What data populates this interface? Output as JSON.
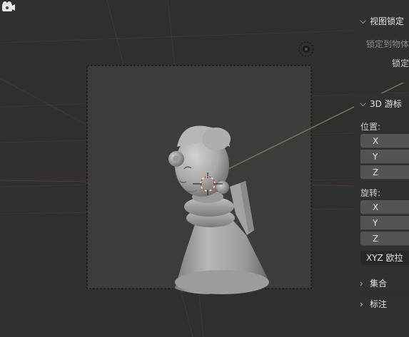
{
  "sidebar": {
    "view_lock_header": "视图锁定",
    "lock_to_object_label": "锁定到物体",
    "lock_label": "锁定",
    "cursor_header": "3D 游标",
    "location_label": "位置:",
    "location_fields": [
      "X",
      "Y",
      "Z"
    ],
    "rotation_label": "旋转:",
    "rotation_fields": [
      "X",
      "Y",
      "Z"
    ],
    "rotation_mode": "XYZ 欧拉",
    "collection_header": "集合",
    "annotation_header": "标注"
  },
  "icons": {
    "expanded": "chevron-down-icon",
    "collapsed": "chevron-right-icon",
    "camera": "camera-icon",
    "cursor": "3d-cursor-icon",
    "light": "light-icon"
  },
  "colors": {
    "viewport_bg": "#2f2f2f",
    "camera_frame_bg": "#3c3c3b",
    "panel_bg": "#303030",
    "field_bg": "#545454",
    "light_line": "#6c7a52",
    "cursor_red": "#d84a4a"
  }
}
